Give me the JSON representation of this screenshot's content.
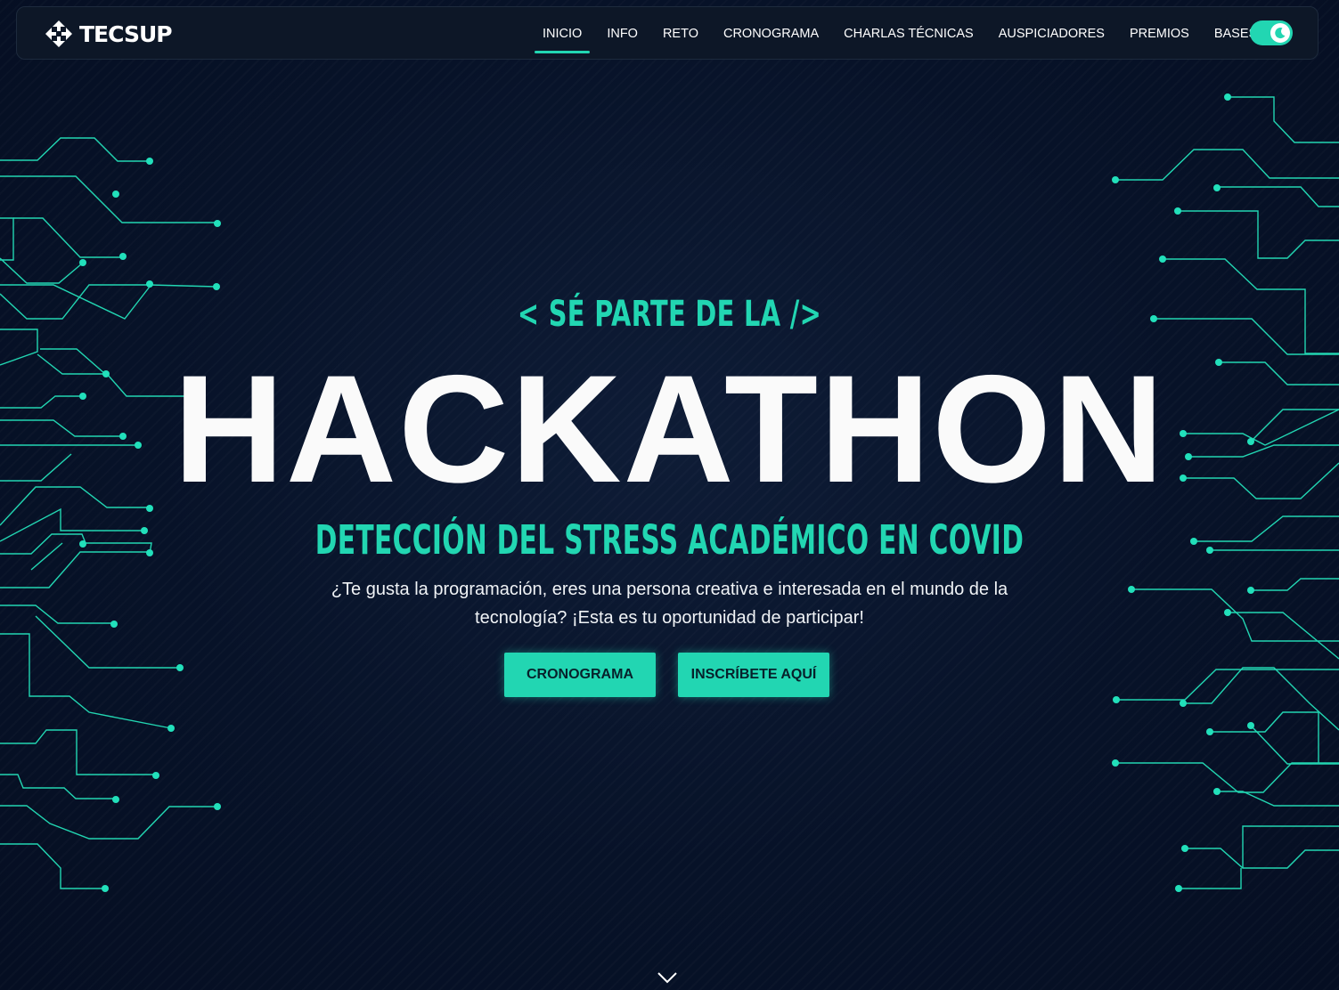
{
  "brand": {
    "logo_text": "TECSUP",
    "accent_color": "#22d6b2",
    "background_color": "#071228"
  },
  "nav": {
    "items": [
      {
        "label": "INICIO",
        "active": true
      },
      {
        "label": "INFO",
        "active": false
      },
      {
        "label": "RETO",
        "active": false
      },
      {
        "label": "CRONOGRAMA",
        "active": false
      },
      {
        "label": "CHARLAS TÉCNICAS",
        "active": false
      },
      {
        "label": "AUSPICIADORES",
        "active": false
      },
      {
        "label": "PREMIOS",
        "active": false
      },
      {
        "label": "BASES",
        "active": false
      }
    ],
    "theme_toggle": {
      "icon": "moon-icon",
      "state": "on"
    }
  },
  "hero": {
    "subtitle": "< SÉ PARTE DE LA />",
    "title": "HACKATHON",
    "headline": "DETECCIÓN DEL STRESS ACADÉMICO EN COVID",
    "description": "¿Te gusta la programación, eres una persona creativa e interesada en el mundo de la tecnología? ¡Esta es tu oportunidad de participar!",
    "buttons": {
      "schedule_label": "CRONOGRAMA",
      "signup_label": "INSCRÍBETE AQUÍ"
    },
    "scroll_icon": "chevron-down-icon"
  }
}
